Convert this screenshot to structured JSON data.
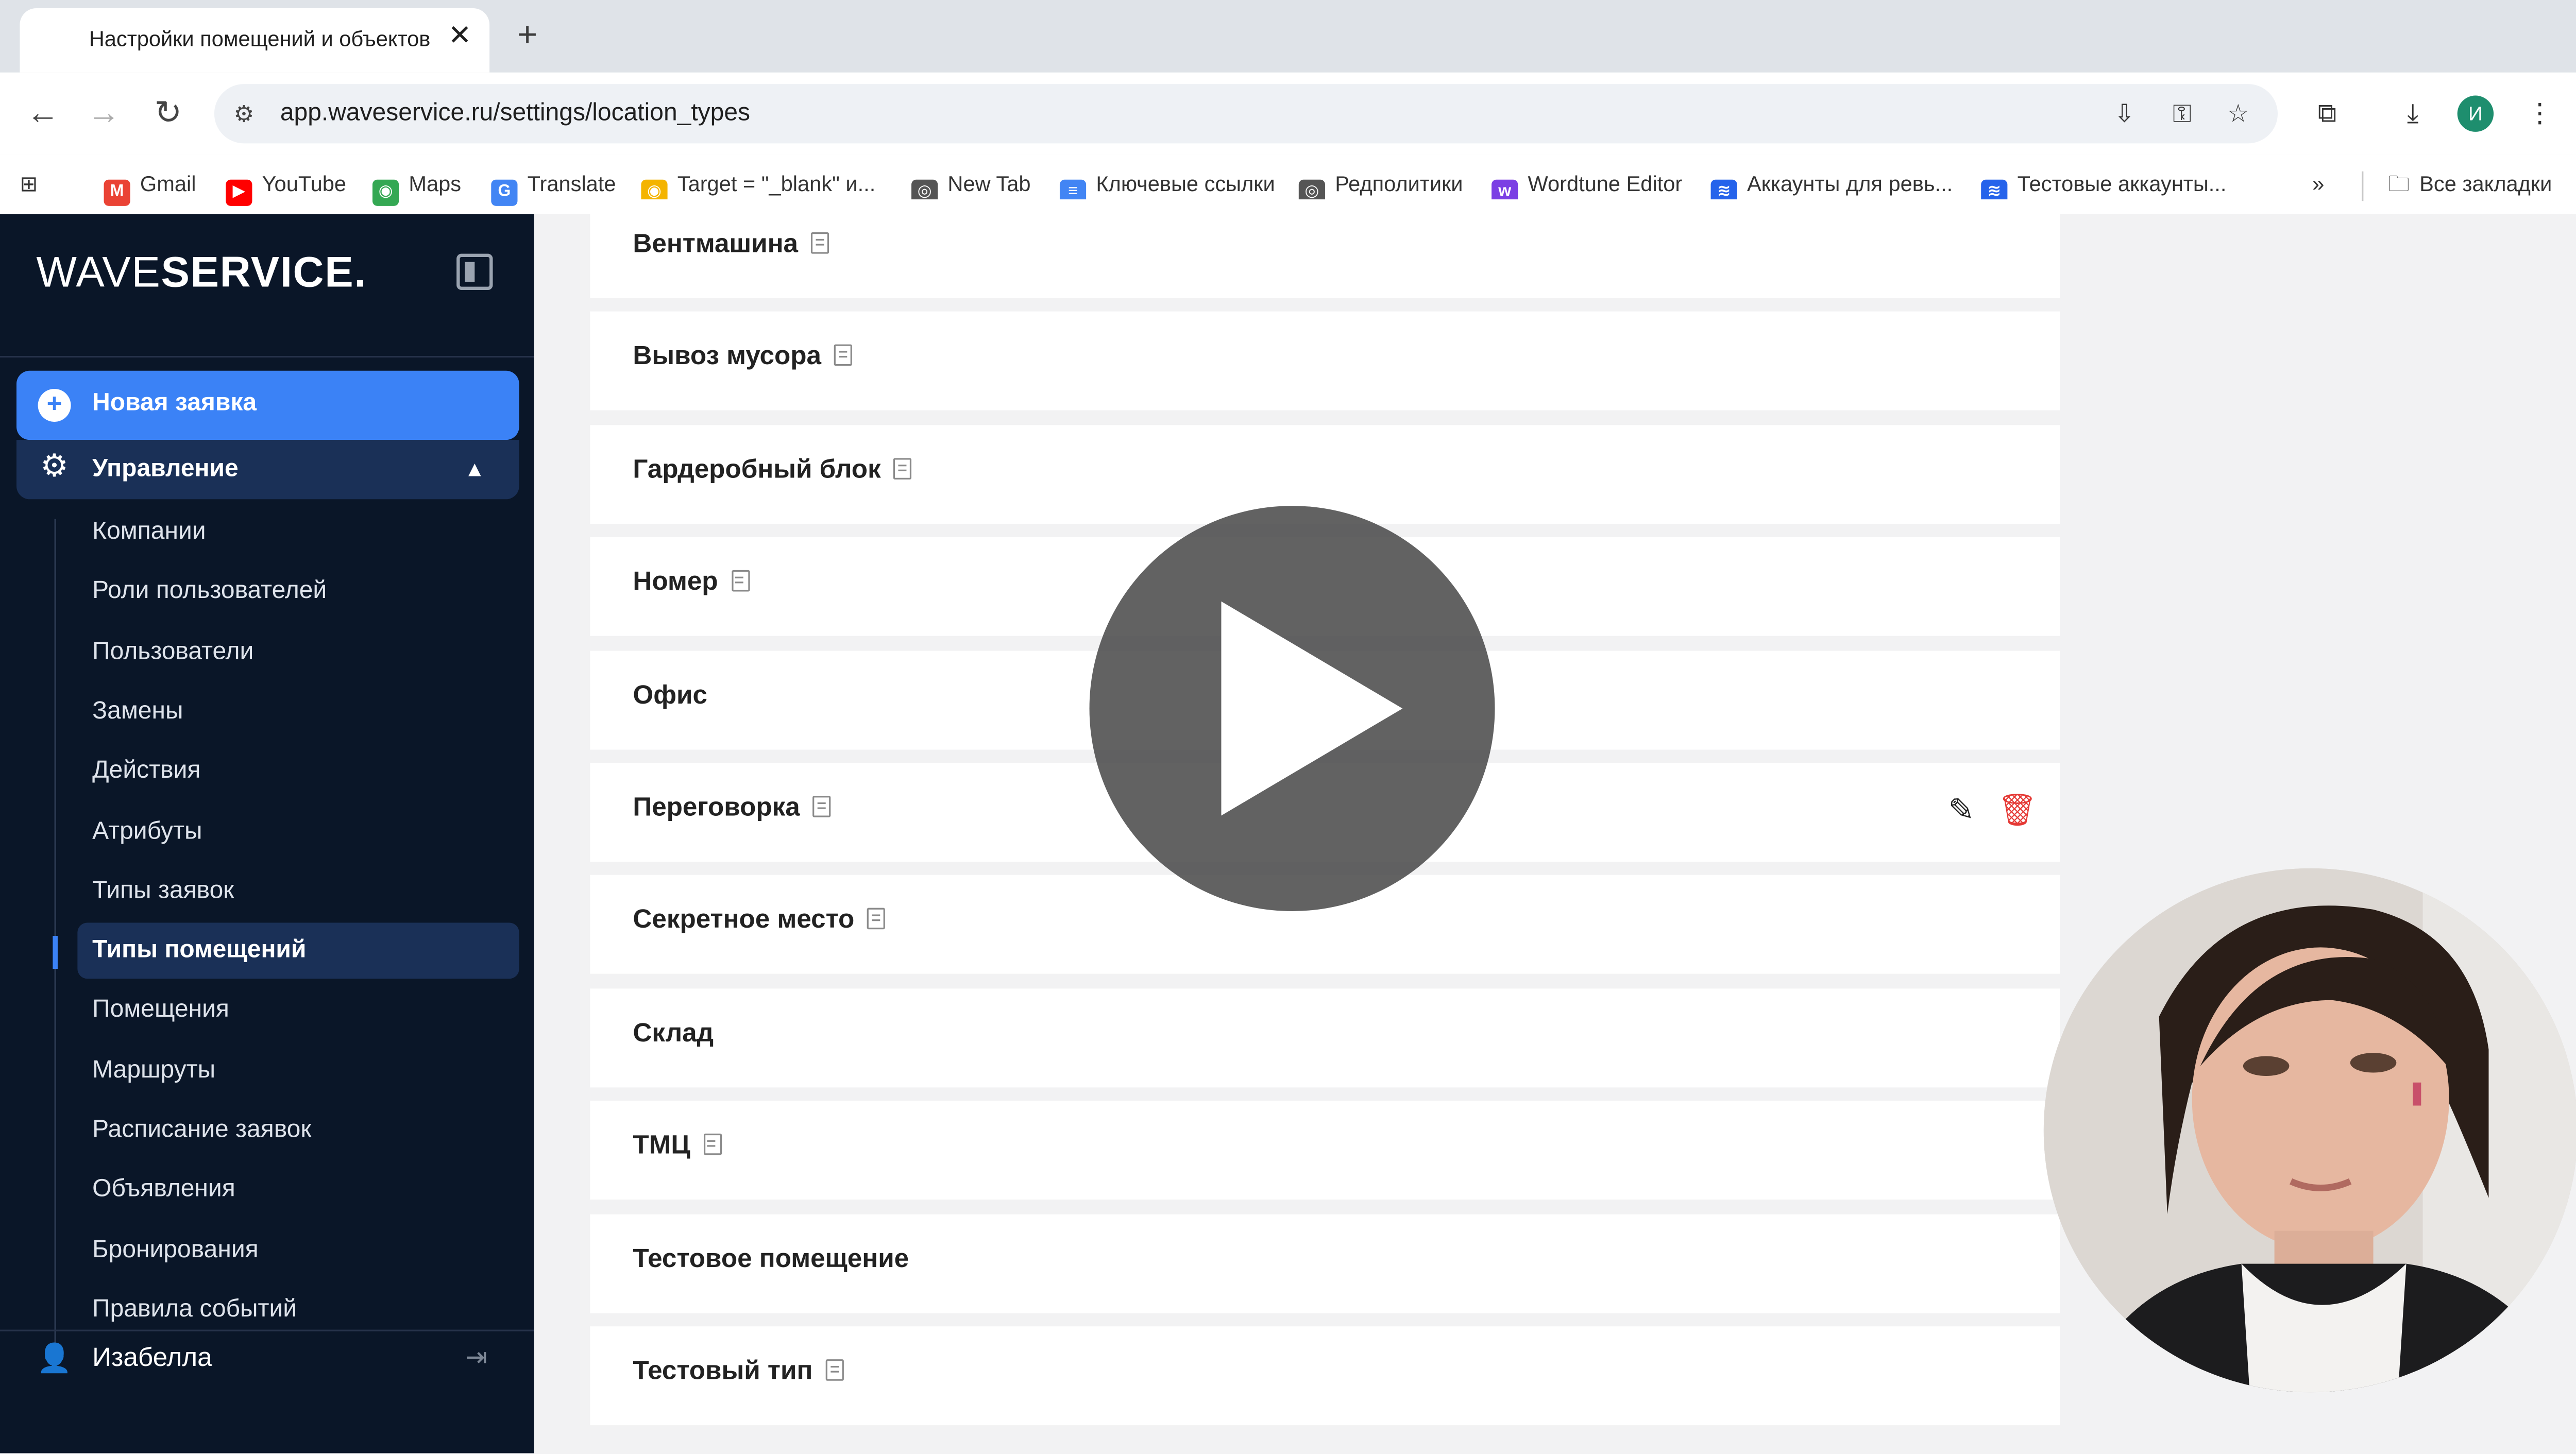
{
  "browser": {
    "tab_title": "Настройки помещений и объектов",
    "tab_close": "✕",
    "new_tab": "+",
    "url": "app.waveservice.ru/settings/location_types",
    "profile_initial": "И",
    "bookmarks": [
      {
        "label": "Gmail",
        "icon": "gmail-icon",
        "glyph": "M",
        "color": "#ea4335"
      },
      {
        "label": "YouTube",
        "icon": "youtube-icon",
        "glyph": "▶",
        "color": "#ff0000"
      },
      {
        "label": "Maps",
        "icon": "maps-icon",
        "glyph": "◉",
        "color": "#34a853"
      },
      {
        "label": "Translate",
        "icon": "translate-icon",
        "glyph": "G",
        "color": "#4285f4"
      },
      {
        "label": "Target = \"_blank\" и...",
        "icon": "target-icon",
        "glyph": "◉",
        "color": "#f4b400"
      },
      {
        "label": "New Tab",
        "icon": "chrome-icon",
        "glyph": "◎",
        "color": "#555555"
      },
      {
        "label": "Ключевые ссылки",
        "icon": "docs-icon",
        "glyph": "≡",
        "color": "#4285f4"
      },
      {
        "label": "Редполитики",
        "icon": "chrome-icon",
        "glyph": "◎",
        "color": "#555555"
      },
      {
        "label": "Wordtune Editor",
        "icon": "wordtune-icon",
        "glyph": "w",
        "color": "#7b3fe4"
      },
      {
        "label": "Аккаунты для ревь...",
        "icon": "tracker-icon",
        "glyph": "≋",
        "color": "#2563eb"
      },
      {
        "label": "Тестовые аккаунты...",
        "icon": "tracker-icon",
        "glyph": "≋",
        "color": "#2563eb"
      }
    ],
    "more_bookmarks": "»",
    "all_bookmarks": "Все закладки"
  },
  "sidebar": {
    "logo_thin": "WAVE",
    "logo_bold": "SERVICE.",
    "new_request": "Новая заявка",
    "management": "Управление",
    "items": [
      "Компании",
      "Роли пользователей",
      "Пользователи",
      "Замены",
      "Действия",
      "Атрибуты",
      "Типы заявок",
      "Типы помещений",
      "Помещения",
      "Маршруты",
      "Расписание заявок",
      "Объявления",
      "Бронирования",
      "Правила событий"
    ],
    "active_item": "Типы помещений",
    "user_name": "Изабелла"
  },
  "location_types": [
    {
      "name": "Вентмашина",
      "has_description": true
    },
    {
      "name": "Вывоз мусора",
      "has_description": true
    },
    {
      "name": "Гардеробный блок",
      "has_description": true
    },
    {
      "name": "Номер",
      "has_description": true
    },
    {
      "name": "Офис",
      "has_description": false
    },
    {
      "name": "Переговорка",
      "has_description": true,
      "hovered": true
    },
    {
      "name": "Секретное место",
      "has_description": true
    },
    {
      "name": "Склад",
      "has_description": false
    },
    {
      "name": "ТМЦ",
      "has_description": true
    },
    {
      "name": "Тестовое помещение",
      "has_description": false
    },
    {
      "name": "Тестовый тип",
      "has_description": true
    }
  ],
  "colors": {
    "sidebar_bg": "#0a1628",
    "accent": "#3b82f6",
    "active_bg": "#1a3057",
    "delete": "#e53935"
  }
}
